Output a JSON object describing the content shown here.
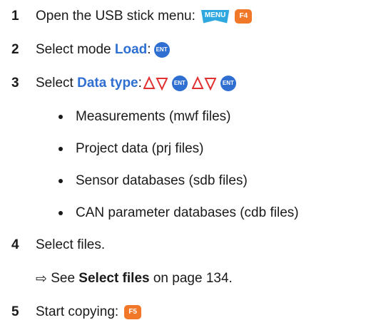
{
  "steps": [
    {
      "num": "1",
      "text": "Open the USB stick menu:",
      "keys": [
        "MENU",
        "F4"
      ]
    },
    {
      "num": "2",
      "text_before": "Select mode ",
      "highlight": "Load",
      "text_after": ":",
      "key": "ENT"
    },
    {
      "num": "3",
      "text_before": "Select ",
      "highlight": "Data type",
      "text_after": ":",
      "key": "ENT"
    },
    {
      "num": "4",
      "text": "Select files."
    },
    {
      "num": "5",
      "text": "Start copying:",
      "key": "F5"
    }
  ],
  "bullets": [
    "Measurements (mwf files)",
    "Project data (prj files)",
    "Sensor databases (sdb files)",
    "CAN parameter databases (cdb files)"
  ],
  "note": {
    "arrow": "⇨",
    "prefix": " See ",
    "link": "Select files",
    "suffix": " on page 134."
  },
  "colors": {
    "highlight": "#2f6fd1",
    "menu_key": "#2ea8df",
    "f_key": "#f07828",
    "arrow_icon": "#e03030"
  }
}
